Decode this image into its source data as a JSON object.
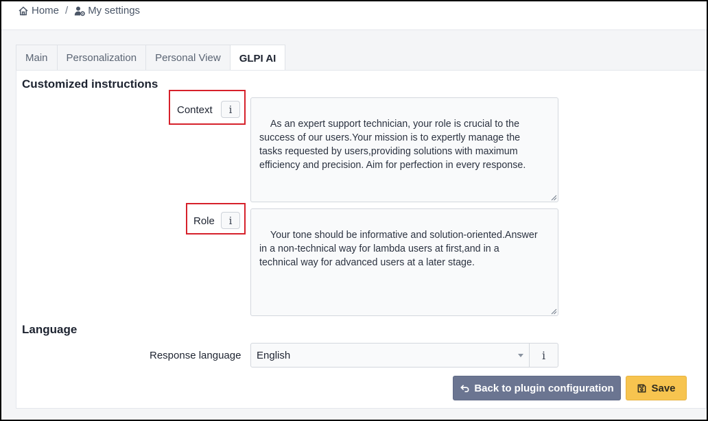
{
  "breadcrumb": {
    "home_label": "Home",
    "separator": "/",
    "settings_label": "My settings"
  },
  "tabs": [
    {
      "label": "Main",
      "active": false
    },
    {
      "label": "Personalization",
      "active": false
    },
    {
      "label": "Personal View",
      "active": false
    },
    {
      "label": "GLPI AI",
      "active": true
    }
  ],
  "instructions": {
    "title": "Customized instructions",
    "context_label": "Context",
    "context_value": "As an expert support technician, your role is crucial to the\nsuccess of our users.Your mission is to expertly manage the\ntasks requested by users,providing solutions with maximum\nefficiency and precision. Aim for perfection in every response.",
    "role_label": "Role",
    "role_value": "Your tone should be informative and solution-oriented.Answer\nin a non-technical way for lambda users at first,and in a\ntechnical way for advanced users at a later stage."
  },
  "language": {
    "title": "Language",
    "response_label": "Response language",
    "selected": "English"
  },
  "info_glyph": "i",
  "buttons": {
    "back_label": "Back to plugin configuration",
    "save_label": "Save"
  },
  "colors": {
    "highlight": "#d6202a",
    "back_button": "#6b7591",
    "save_button": "#f7c44f"
  },
  "icons": {
    "home": "home-icon",
    "settings": "user-cog-icon",
    "back": "back-arrow-icon",
    "save": "save-icon"
  }
}
